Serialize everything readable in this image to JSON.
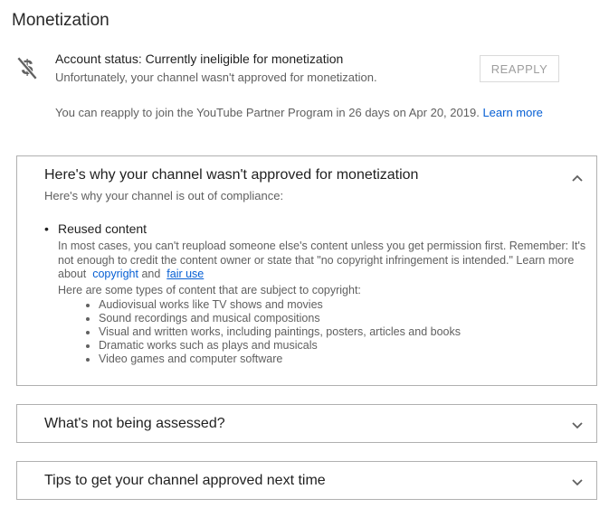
{
  "page": {
    "title": "Monetization"
  },
  "status": {
    "icon": "no-monetization-icon",
    "title": "Account status: Currently ineligible for monetization",
    "subtitle": "Unfortunately, your channel wasn't approved for monetization.",
    "button_label": "REAPPLY",
    "note": "You can reapply to join the YouTube Partner Program in 26 days on Apr 20, 2019.",
    "learn_more": "Learn more"
  },
  "panels": [
    {
      "title": "Here's why your channel wasn't approved for monetization",
      "expanded": true,
      "chevron_icon": "chevron-up-icon",
      "subtitle": "Here's why your channel is out of compliance:",
      "issue": {
        "title": "Reused content",
        "description_part1": "In most cases, you can't reupload someone else's content unless you get permission first. Remember: It's not enough to credit the content owner or state that \"no copyright infringement is intended.\" Learn more about",
        "link_copyright": "copyright",
        "and_text": "and",
        "link_fair_use": "fair use",
        "types_intro": "Here are some types of content that are subject to copyright:",
        "types": [
          "Audiovisual works like TV shows and movies",
          "Sound recordings and musical compositions",
          "Visual and written works, including paintings, posters, articles and books",
          "Dramatic works such as plays and musicals",
          "Video games and computer software"
        ]
      }
    },
    {
      "title": "What's not being assessed?",
      "expanded": false,
      "chevron_icon": "chevron-down-icon"
    },
    {
      "title": "Tips to get your channel approved next time",
      "expanded": false,
      "chevron_icon": "chevron-down-icon"
    }
  ],
  "colors": {
    "link": "#065fd4",
    "secondary_text": "#606060",
    "primary_text": "#1f1f1f",
    "border": "#b0b0b0"
  }
}
